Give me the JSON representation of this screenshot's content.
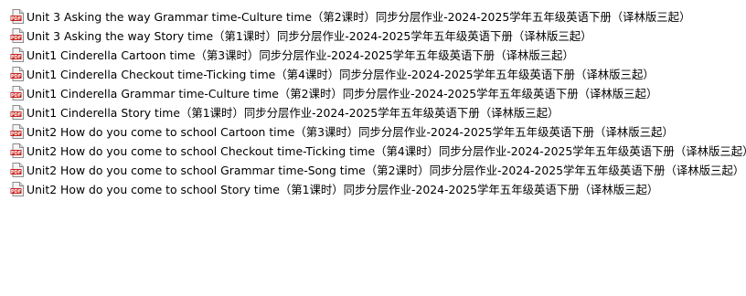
{
  "icon": "pdf-file-icon",
  "colors": {
    "pdf_badge": "#c8231c",
    "page": "#f4f4f4",
    "page_border": "#8a8a8a",
    "text": "#000000"
  },
  "files": [
    {
      "name": "Unit 3 Asking the way Grammar time-Culture time（第2课时）同步分层作业-2024-2025学年五年级英语下册（译林版三起）"
    },
    {
      "name": "Unit 3 Asking the way Story time（第1课时）同步分层作业-2024-2025学年五年级英语下册（译林版三起）"
    },
    {
      "name": "Unit1 Cinderella Cartoon time（第3课时）同步分层作业-2024-2025学年五年级英语下册（译林版三起）"
    },
    {
      "name": "Unit1 Cinderella Checkout time-Ticking time（第4课时）同步分层作业-2024-2025学年五年级英语下册（译林版三起）"
    },
    {
      "name": "Unit1 Cinderella Grammar time-Culture time（第2课时）同步分层作业-2024-2025学年五年级英语下册（译林版三起）"
    },
    {
      "name": "Unit1 Cinderella Story time（第1课时）同步分层作业-2024-2025学年五年级英语下册（译林版三起）"
    },
    {
      "name": "Unit2 How do you come to school Cartoon time（第3课时）同步分层作业-2024-2025学年五年级英语下册（译林版三起）"
    },
    {
      "name": "Unit2 How do you come to school Checkout time-Ticking time（第4课时）同步分层作业-2024-2025学年五年级英语下册（译林版三起）"
    },
    {
      "name": "Unit2 How do you come to school Grammar time-Song time（第2课时）同步分层作业-2024-2025学年五年级英语下册（译林版三起）"
    },
    {
      "name": "Unit2 How do you come to school Story time（第1课时）同步分层作业-2024-2025学年五年级英语下册（译林版三起）"
    }
  ]
}
